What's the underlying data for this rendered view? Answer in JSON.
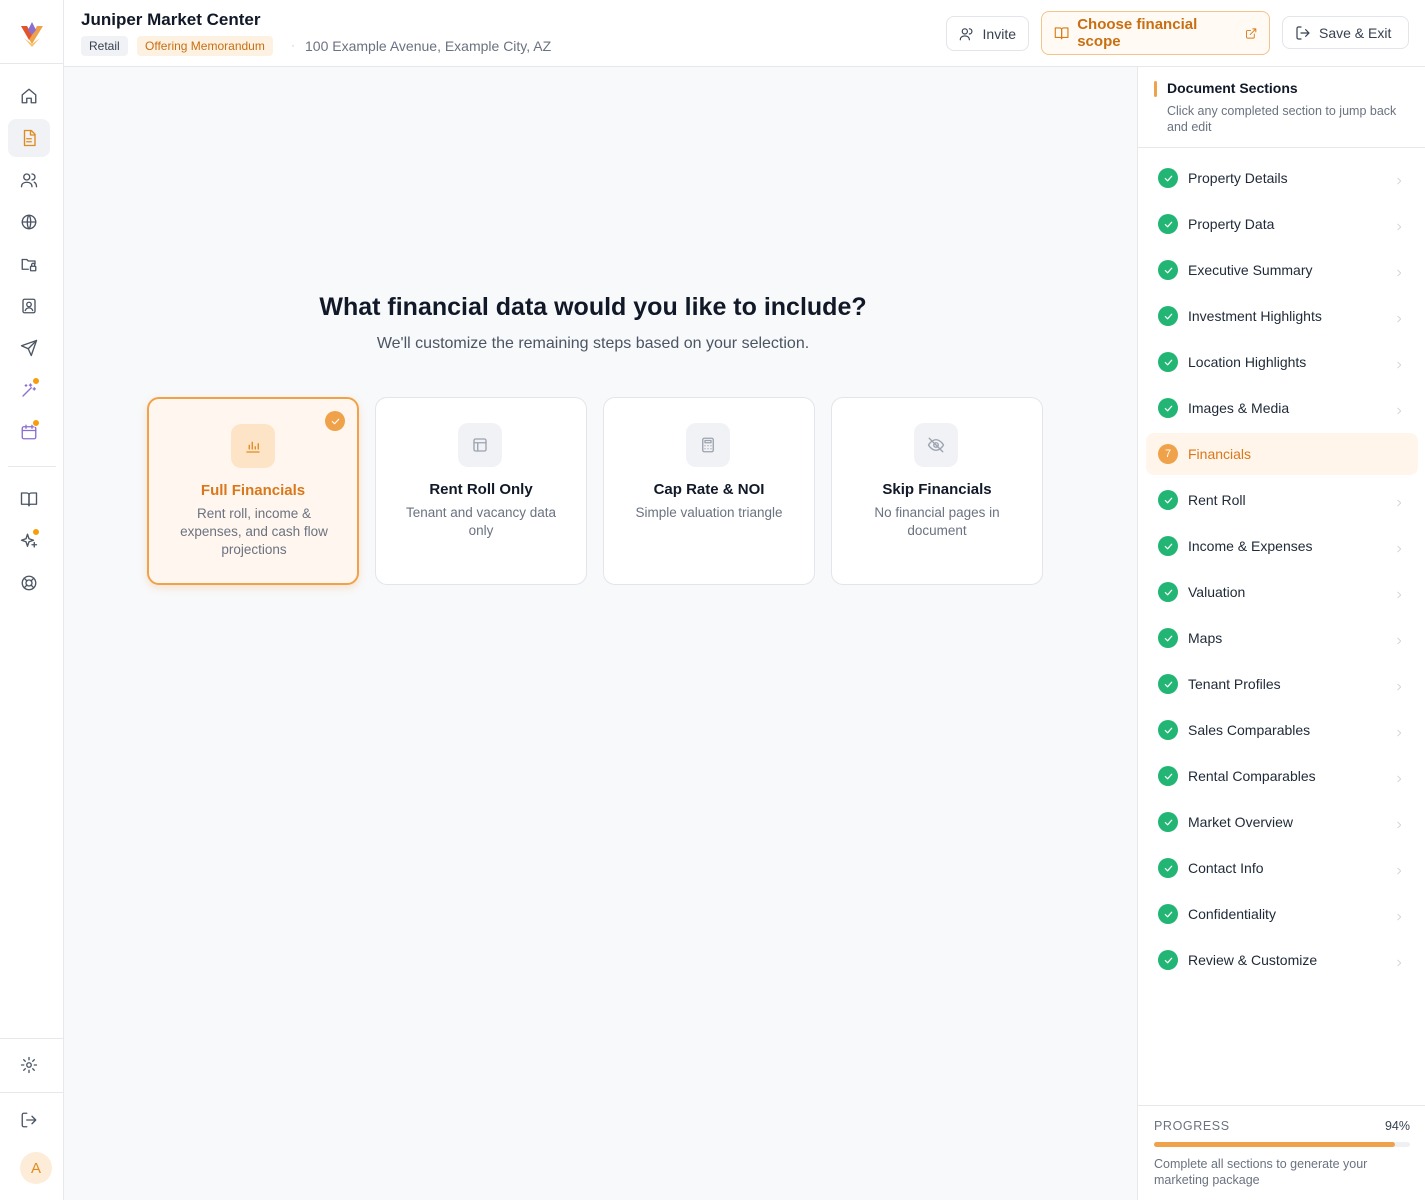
{
  "header": {
    "title": "Juniper Market Center",
    "tag_type": "Retail",
    "tag_doc": "Offering Memorandum",
    "separator": "·",
    "address": "100 Example Avenue, Example City, AZ",
    "invite_label": "Invite",
    "scope_label": "Choose financial scope",
    "save_label": "Save & Exit"
  },
  "rail": {
    "icons": [
      "home-icon",
      "document-icon",
      "users-icon",
      "globe-icon",
      "folder-lock-icon",
      "contact-card-icon",
      "send-icon",
      "magic-wand-icon",
      "calendar-icon",
      "book-icon",
      "sparkle-icon",
      "lifebuoy-icon",
      "gear-icon",
      "logout-icon"
    ],
    "active": "document-icon",
    "avatar_initial": "A"
  },
  "main": {
    "question": "What financial data would you like to include?",
    "subtitle": "We'll customize the remaining steps based on your selection.",
    "options": [
      {
        "title": "Full Financials",
        "desc": "Rent roll, income & expenses, and cash flow projections",
        "icon": "bar-chart-icon",
        "selected": true
      },
      {
        "title": "Rent Roll Only",
        "desc": "Tenant and vacancy data only",
        "icon": "table-icon",
        "selected": false
      },
      {
        "title": "Cap Rate & NOI",
        "desc": "Simple valuation triangle",
        "icon": "calculator-icon",
        "selected": false
      },
      {
        "title": "Skip Financials",
        "desc": "No financial pages in document",
        "icon": "eye-off-icon",
        "selected": false
      }
    ]
  },
  "sidebar": {
    "heading": "Document Sections",
    "description": "Click any completed section to jump back and edit",
    "sections": [
      {
        "label": "Property Details",
        "status": "complete"
      },
      {
        "label": "Property Data",
        "status": "complete"
      },
      {
        "label": "Executive Summary",
        "status": "complete"
      },
      {
        "label": "Investment Highlights",
        "status": "complete"
      },
      {
        "label": "Location Highlights",
        "status": "complete"
      },
      {
        "label": "Images & Media",
        "status": "complete"
      },
      {
        "label": "Financials",
        "status": "current",
        "step": "7"
      },
      {
        "label": "Rent Roll",
        "status": "complete"
      },
      {
        "label": "Income & Expenses",
        "status": "complete"
      },
      {
        "label": "Valuation",
        "status": "complete"
      },
      {
        "label": "Maps",
        "status": "complete"
      },
      {
        "label": "Tenant Profiles",
        "status": "complete"
      },
      {
        "label": "Sales Comparables",
        "status": "complete"
      },
      {
        "label": "Rental Comparables",
        "status": "complete"
      },
      {
        "label": "Market Overview",
        "status": "complete"
      },
      {
        "label": "Contact Info",
        "status": "complete"
      },
      {
        "label": "Confidentiality",
        "status": "complete"
      },
      {
        "label": "Review & Customize",
        "status": "complete"
      }
    ],
    "progress_label": "PROGRESS",
    "progress_value": "94%",
    "progress_fraction": 0.94,
    "progress_desc": "Complete all sections to generate your marketing package"
  },
  "colors": {
    "accent": "#f0a24a",
    "accent_text": "#d9781a",
    "success": "#22b573"
  }
}
